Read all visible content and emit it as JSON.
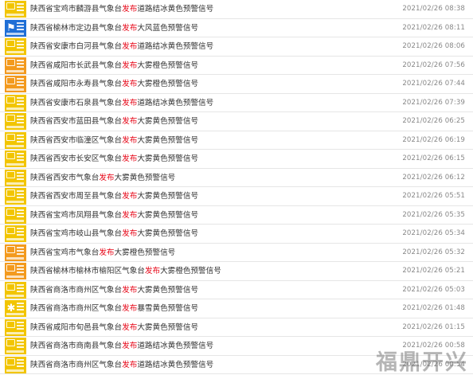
{
  "highlight_word": "发布",
  "colors": {
    "highlight": "#e60012",
    "yellow_badge": "#f2c500",
    "blue_badge": "#1f6fd6",
    "orange_badge": "#f39a1e"
  },
  "warnings": [
    {
      "title": "陕西省宝鸡市麟游县气象台发布道路结冰黄色预警信号",
      "time": "2021/02/26 08:38",
      "badge": "yellow",
      "icon": "road-ice-warning-icon"
    },
    {
      "title": "陕西省榆林市定边县气象台发布大风蓝色预警信号",
      "time": "2021/02/26 08:11",
      "badge": "blue",
      "icon": "gale-warning-icon"
    },
    {
      "title": "陕西省安康市白河县气象台发布道路结冰黄色预警信号",
      "time": "2021/02/26 08:06",
      "badge": "yellow",
      "icon": "road-ice-warning-icon"
    },
    {
      "title": "陕西省咸阳市长武县气象台发布大雾橙色预警信号",
      "time": "2021/02/26 07:56",
      "badge": "orange",
      "icon": "fog-warning-icon"
    },
    {
      "title": "陕西省咸阳市永寿县气象台发布大雾橙色预警信号",
      "time": "2021/02/26 07:44",
      "badge": "orange",
      "icon": "fog-warning-icon"
    },
    {
      "title": "陕西省安康市石泉县气象台发布道路结冰黄色预警信号",
      "time": "2021/02/26 07:39",
      "badge": "yellow",
      "icon": "road-ice-warning-icon"
    },
    {
      "title": "陕西省西安市蓝田县气象台发布大雾黄色预警信号",
      "time": "2021/02/26 06:25",
      "badge": "yellow",
      "icon": "fog-warning-icon"
    },
    {
      "title": "陕西省西安市临潼区气象台发布大雾黄色预警信号",
      "time": "2021/02/26 06:19",
      "badge": "yellow",
      "icon": "fog-warning-icon"
    },
    {
      "title": "陕西省西安市长安区气象台发布大雾黄色预警信号",
      "time": "2021/02/26 06:15",
      "badge": "yellow",
      "icon": "fog-warning-icon"
    },
    {
      "title": "陕西省西安市气象台发布大雾黄色预警信号",
      "time": "2021/02/26 06:12",
      "badge": "yellow",
      "icon": "fog-warning-icon"
    },
    {
      "title": "陕西省西安市周至县气象台发布大雾黄色预警信号",
      "time": "2021/02/26 05:51",
      "badge": "yellow",
      "icon": "fog-warning-icon"
    },
    {
      "title": "陕西省宝鸡市凤翔县气象台发布大雾黄色预警信号",
      "time": "2021/02/26 05:35",
      "badge": "yellow",
      "icon": "fog-warning-icon"
    },
    {
      "title": "陕西省宝鸡市岐山县气象台发布大雾黄色预警信号",
      "time": "2021/02/26 05:34",
      "badge": "yellow",
      "icon": "fog-warning-icon"
    },
    {
      "title": "陕西省宝鸡市气象台发布大雾橙色预警信号",
      "time": "2021/02/26 05:32",
      "badge": "orange",
      "icon": "fog-warning-icon"
    },
    {
      "title": "陕西省榆林市榆林市榆阳区气象台发布大雾橙色预警信号",
      "time": "2021/02/26 05:21",
      "badge": "orange",
      "icon": "fog-warning-icon"
    },
    {
      "title": "陕西省商洛市商州区气象台发布大雾黄色预警信号",
      "time": "2021/02/26 05:03",
      "badge": "yellow",
      "icon": "fog-warning-icon"
    },
    {
      "title": "陕西省商洛市商州区气象台发布暴雪黄色预警信号",
      "time": "2021/02/26 01:48",
      "badge": "yellow",
      "icon": "snowstorm-warning-icon"
    },
    {
      "title": "陕西省咸阳市旬邑县气象台发布大雾黄色预警信号",
      "time": "2021/02/26 01:15",
      "badge": "yellow",
      "icon": "fog-warning-icon"
    },
    {
      "title": "陕西省商洛市商南县气象台发布道路结冰黄色预警信号",
      "time": "2021/02/26 00:58",
      "badge": "yellow",
      "icon": "road-ice-warning-icon"
    },
    {
      "title": "陕西省商洛市商州区气象台发布道路结冰黄色预警信号",
      "time": "2021/02/26 00:54",
      "badge": "yellow",
      "icon": "road-ice-warning-icon"
    }
  ],
  "watermark": "福鼎开兴"
}
